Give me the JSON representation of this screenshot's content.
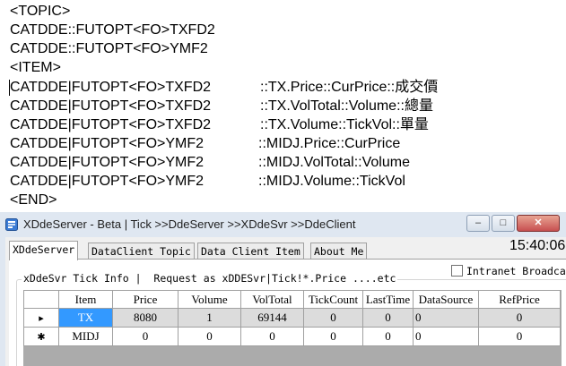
{
  "editor": {
    "lines": [
      {
        "text": "<TOPIC>",
        "col2": ""
      },
      {
        "text": "CATDDE::FUTOPT<FO>TXFD2",
        "col2": ""
      },
      {
        "text": "CATDDE::FUTOPT<FO>YMF2",
        "col2": ""
      },
      {
        "text": "<ITEM>",
        "col2": ""
      },
      {
        "text": "CATDDE|FUTOPT<FO>TXFD2",
        "col2": "::TX.Price::CurPrice::成交價"
      },
      {
        "text": "CATDDE|FUTOPT<FO>TXFD2",
        "col2": "::TX.VolTotal::Volume::總量"
      },
      {
        "text": "CATDDE|FUTOPT<FO>TXFD2",
        "col2": "::TX.Volume::TickVol::單量"
      },
      {
        "text": "CATDDE|FUTOPT<FO>YMF2",
        "col2": "::MIDJ.Price::CurPrice"
      },
      {
        "text": "CATDDE|FUTOPT<FO>YMF2",
        "col2": "::MIDJ.VolTotal::Volume"
      },
      {
        "text": "CATDDE|FUTOPT<FO>YMF2",
        "col2": "::MIDJ.Volume::TickVol"
      },
      {
        "text": "<END>",
        "col2": ""
      }
    ]
  },
  "window": {
    "title": "XDdeServer - Beta | Tick >>DdeServer >>XDdeSvr >>DdeClient",
    "minimize_glyph": "–",
    "maximize_glyph": "□",
    "close_glyph": "✕",
    "accent": "#3399ff"
  },
  "tabs": [
    {
      "label": "XDdeServer",
      "active": true
    },
    {
      "label": "DataClient Topic",
      "active": false
    },
    {
      "label": "Data Client Item",
      "active": false
    },
    {
      "label": "About Me",
      "active": false
    }
  ],
  "clock": "15:40:06",
  "intranet_label": "Intranet Broadca",
  "group_caption": "xDdeSvr Tick Info |  Request as xDDESvr|Tick!*.Price ....etc",
  "grid": {
    "columns": [
      "Item",
      "Price",
      "Volume",
      "VolTotal",
      "TickCount",
      "LastTime",
      "DataSource",
      "RefPrice"
    ],
    "rows": [
      {
        "indicator": "▸",
        "cells": [
          "TX",
          "8080",
          "1",
          "69144",
          "0",
          "0",
          "0",
          "0"
        ]
      },
      {
        "indicator": "✱",
        "cells": [
          "MIDJ",
          "0",
          "0",
          "0",
          "0",
          "0",
          "0",
          "0"
        ]
      }
    ]
  }
}
